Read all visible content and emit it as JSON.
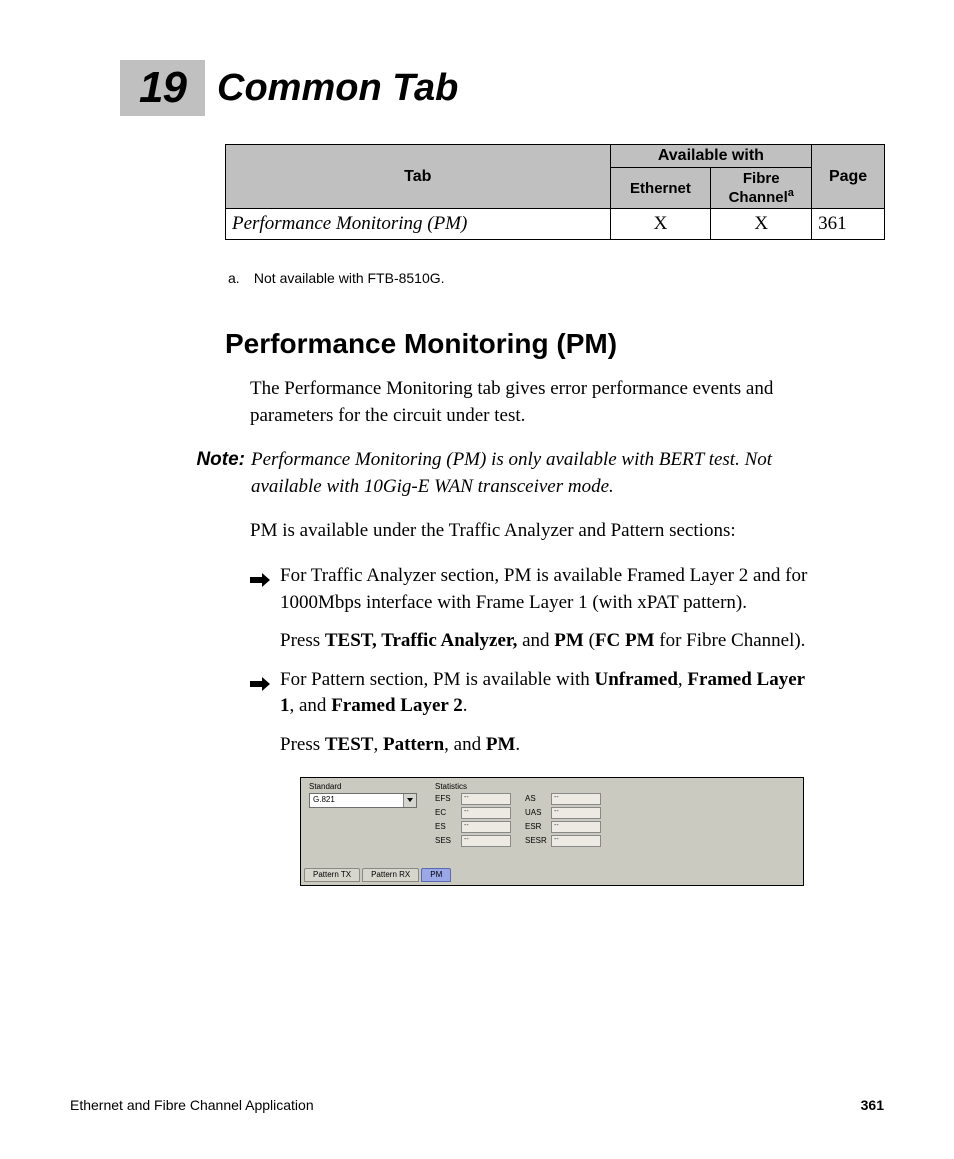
{
  "chapter": {
    "number": "19",
    "title": "Common Tab"
  },
  "table": {
    "headers": {
      "tab": "Tab",
      "available_with": "Available with",
      "ethernet": "Ethernet",
      "fibre_channel": "Fibre Channel",
      "fibre_channel_fn": "a",
      "page": "Page"
    },
    "rows": [
      {
        "tab": "Performance Monitoring (PM)",
        "ethernet": "X",
        "fibre_channel": "X",
        "page": "361"
      }
    ]
  },
  "footnote_a": {
    "label": "a.",
    "text": "Not available with FTB-8510G."
  },
  "section_heading": "Performance Monitoring (PM)",
  "intro_para": "The Performance Monitoring tab gives error performance events and parameters for the circuit under test.",
  "note": {
    "label": "Note:",
    "text": "Performance Monitoring (PM) is only available with BERT test. Not available with 10Gig-E WAN transceiver mode."
  },
  "avail_line": "PM is available under the Traffic Analyzer and Pattern sections:",
  "bullets": [
    {
      "main_pre": "For Traffic Analyzer section, PM is available Framed Layer 2 and for 1000Mbps interface with Frame Layer 1 (with xPAT pattern).",
      "press_pre": "Press ",
      "b1": "TEST, Traffic Analyzer,",
      "mid": " and ",
      "b2": "PM",
      "after": " (",
      "b3": "FC PM",
      "tail": " for Fibre Channel)."
    },
    {
      "main_pre": "For Pattern section, PM is available with ",
      "m_b1": "Unframed",
      "m_sep1": ", ",
      "m_b2": "Framed Layer 1",
      "m_sep2": ", and ",
      "m_b3": "Framed Layer 2",
      "m_tail": ".",
      "press_pre": "Press ",
      "b1": "TEST",
      "sep1": ", ",
      "b2": "Pattern",
      "sep2": ", and ",
      "b3": "PM",
      "tail": "."
    }
  ],
  "screenshot": {
    "standard_label": "Standard",
    "standard_value": "G.821",
    "statistics_label": "Statistics",
    "stats_left": [
      {
        "name": "EFS",
        "value": "--"
      },
      {
        "name": "EC",
        "value": "--"
      },
      {
        "name": "ES",
        "value": "--"
      },
      {
        "name": "SES",
        "value": "--"
      }
    ],
    "stats_right": [
      {
        "name": "AS",
        "value": "--"
      },
      {
        "name": "UAS",
        "value": "--"
      },
      {
        "name": "ESR",
        "value": "--"
      },
      {
        "name": "SESR",
        "value": "--"
      }
    ],
    "tabs": [
      {
        "label": "Pattern TX",
        "active": false
      },
      {
        "label": "Pattern RX",
        "active": false
      },
      {
        "label": "PM",
        "active": true
      }
    ]
  },
  "footer": {
    "left": "Ethernet and Fibre Channel Application",
    "page": "361"
  }
}
